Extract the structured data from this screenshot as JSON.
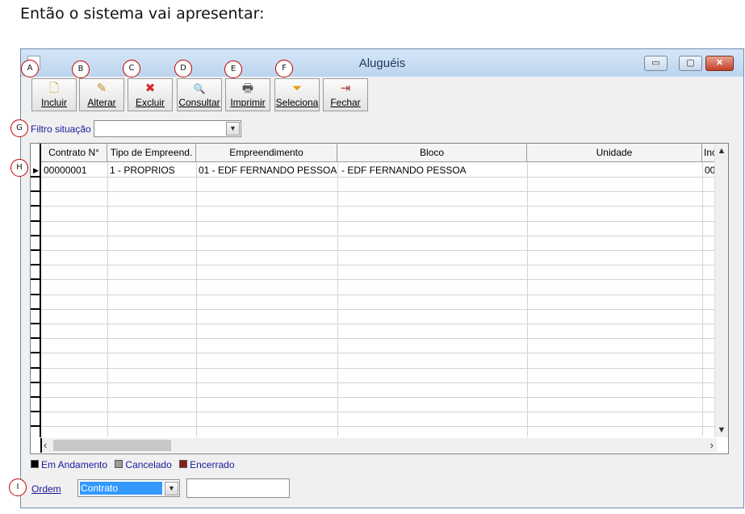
{
  "caption": "Então o sistema vai apresentar:",
  "window": {
    "title": "Aluguéis",
    "buttons": {
      "minimize": "▭",
      "maximize": "▢",
      "close": "✕"
    }
  },
  "toolbar": [
    {
      "label": "Incluir",
      "icon": "new-doc-icon",
      "glyph": "🗋",
      "color": "#c9a227"
    },
    {
      "label": "Alterar",
      "icon": "edit-icon",
      "glyph": "✎",
      "color": "#c58a1c"
    },
    {
      "label": "Excluir",
      "icon": "delete-x-icon",
      "glyph": "✖",
      "color": "#d22b2b"
    },
    {
      "label": "Consultar",
      "icon": "search-icon",
      "glyph": "🔍",
      "color": "#6a7f9a"
    },
    {
      "label": "Imprimir",
      "icon": "printer-icon",
      "glyph": "🖶",
      "color": "#555555"
    },
    {
      "label": "Seleciona",
      "icon": "filter-icon",
      "glyph": "⏷",
      "color": "#e0a000"
    },
    {
      "label": "Fechar",
      "icon": "exit-door-icon",
      "glyph": "⇥",
      "color": "#b23a3a"
    }
  ],
  "filter": {
    "label": "Filtro situação",
    "value": ""
  },
  "grid": {
    "columns": [
      "Contrato N°",
      "Tipo de Empreend.",
      "Empreendimento",
      "Bloco",
      "Unidade",
      "Inc"
    ],
    "rows": [
      [
        "00000001",
        "1 - PROPRIOS",
        "01 - EDF FERNANDO PESSOA",
        "- EDF FERNANDO PESSOA",
        "",
        "00"
      ]
    ]
  },
  "legend": [
    {
      "label": "Em Andamento",
      "color": "#000000"
    },
    {
      "label": "Cancelado",
      "color": "#9a9a9a"
    },
    {
      "label": "Encerrado",
      "color": "#8b1a1a"
    }
  ],
  "order": {
    "label": "Ordem",
    "value": "Contrato",
    "search_value": ""
  },
  "markers": [
    "A",
    "B",
    "C",
    "D",
    "E",
    "F",
    "G",
    "H",
    "I"
  ]
}
